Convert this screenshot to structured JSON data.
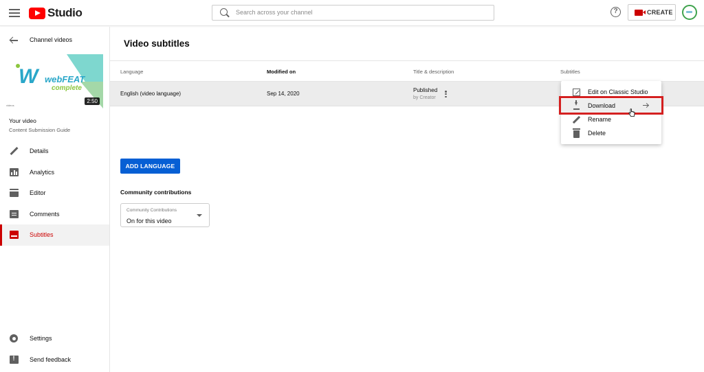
{
  "header": {
    "logo_text": "Studio",
    "search_placeholder": "Search across your channel",
    "help_glyph": "?",
    "create_label": "CREATE"
  },
  "sidebar": {
    "back_label": "Channel videos",
    "thumbnail": {
      "brand_line1": "webFEAT",
      "brand_line2": "complete",
      "duration": "2:50",
      "tiny_text": "videos"
    },
    "video_title": "Your video",
    "video_subtitle": "Content Submission Guide",
    "items": [
      {
        "label": "Details",
        "icon": "pencil-icon"
      },
      {
        "label": "Analytics",
        "icon": "analytics-icon"
      },
      {
        "label": "Editor",
        "icon": "editor-icon"
      },
      {
        "label": "Comments",
        "icon": "comments-icon"
      },
      {
        "label": "Subtitles",
        "icon": "subtitles-icon",
        "active": true
      }
    ],
    "bottom_items": [
      {
        "label": "Settings",
        "icon": "gear-icon"
      },
      {
        "label": "Send feedback",
        "icon": "feedback-icon"
      }
    ]
  },
  "main": {
    "title": "Video subtitles",
    "columns": [
      "Language",
      "Modified on",
      "Title & description",
      "Subtitles"
    ],
    "rows": [
      {
        "language": "English (video language)",
        "modified": "Sep 14, 2020",
        "status": "Published",
        "by": "by Creator"
      }
    ],
    "add_language_label": "ADD LANGUAGE",
    "community_title": "Community contributions",
    "community_dropdown": {
      "label": "Community Contributions",
      "value": "On for this video"
    }
  },
  "context_menu": {
    "items": [
      {
        "label": "Edit on Classic Studio",
        "icon": "open-external-icon"
      },
      {
        "label": "Download",
        "icon": "download-icon",
        "hover": true
      },
      {
        "label": "Rename",
        "icon": "pencil-icon"
      },
      {
        "label": "Delete",
        "icon": "trash-icon"
      }
    ]
  },
  "colors": {
    "accent": "#065fd4",
    "brand_red": "#ff0000",
    "active_red": "#cc0000",
    "highlight_red": "#d42020"
  }
}
